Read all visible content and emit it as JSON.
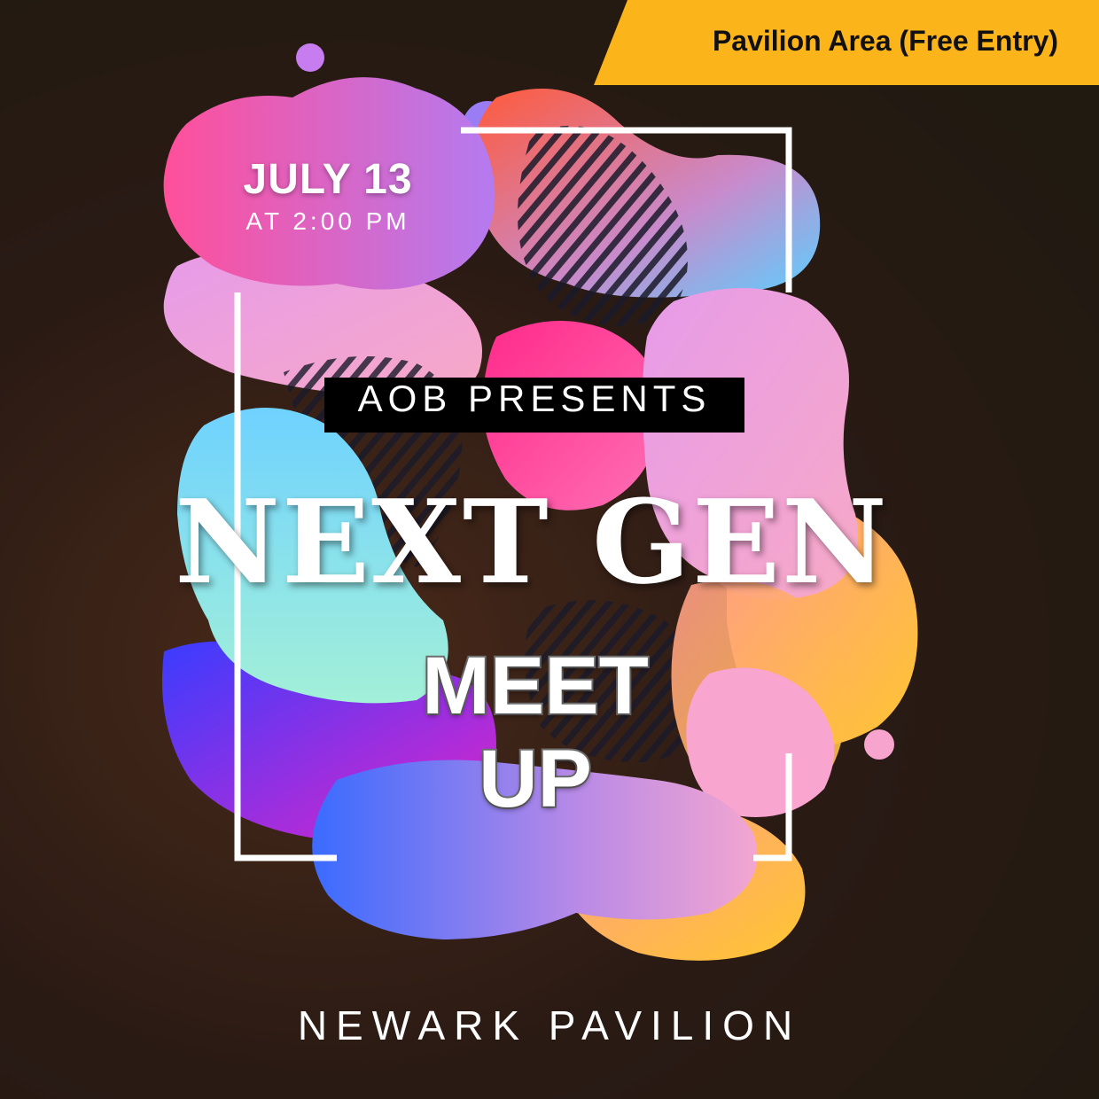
{
  "badge": {
    "text": "Pavilion Area (Free Entry)",
    "color": "#fbb41a"
  },
  "event": {
    "date": "JULY 13",
    "time": "AT 2:00 PM",
    "presenter": "AOB PRESENTS",
    "title": "NEXT GEN",
    "subtitle": "MEET UP",
    "venue": "NEWARK PAVILION"
  }
}
